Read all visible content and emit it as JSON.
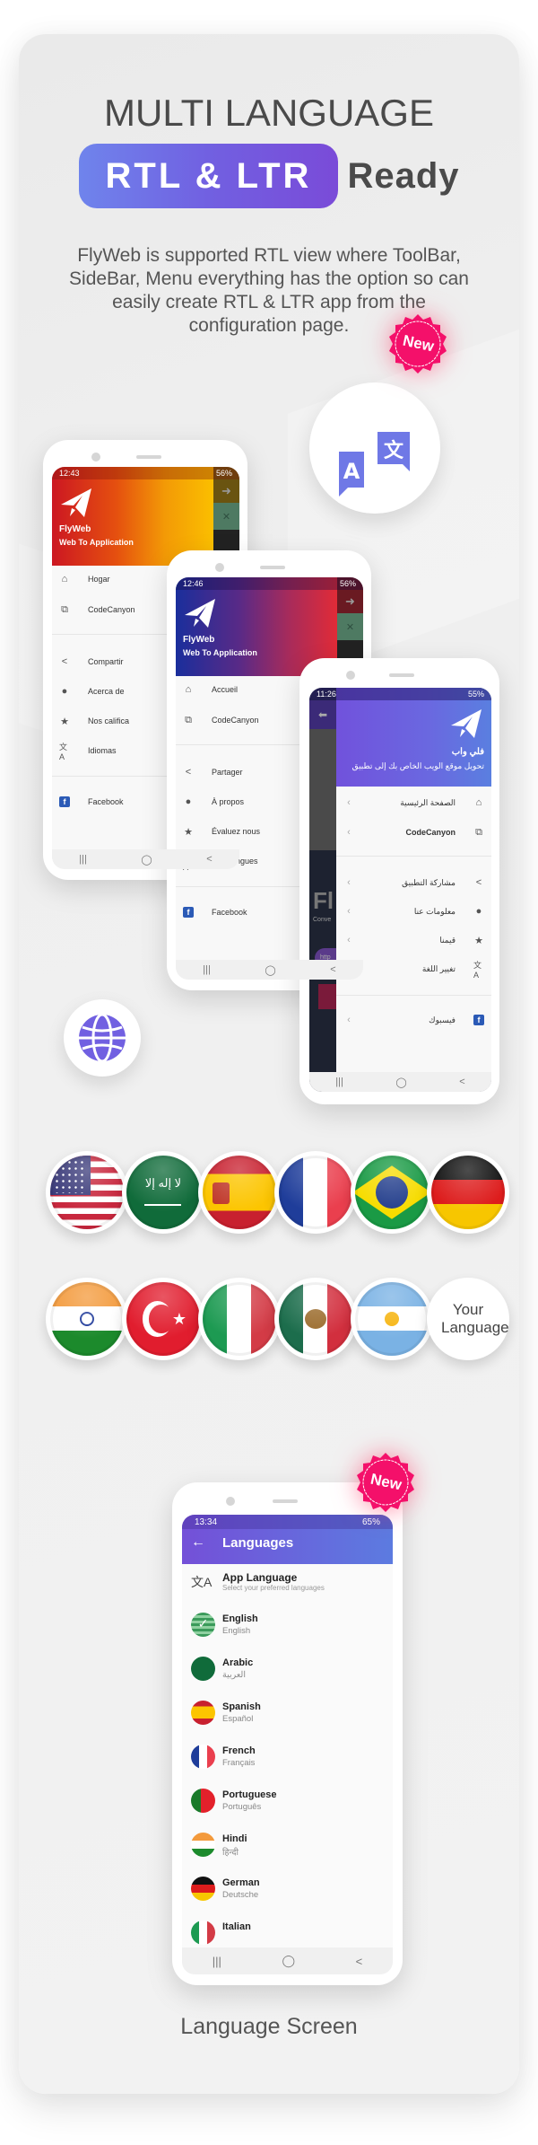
{
  "header": {
    "title": "MULTI LANGUAGE",
    "pill": "RTL & LTR",
    "ready": "Ready",
    "description": "FlyWeb is supported RTL view where ToolBar, SideBar, Menu everything has the option so can easily create RTL & LTR app from the configuration page."
  },
  "badges": {
    "new": "New"
  },
  "icons": {
    "translate": "translate-icon",
    "globe": "globe-icon"
  },
  "colors": {
    "accent": "#7160e1",
    "new_badge": "#ff1a5a",
    "text": "#4a4a4a"
  },
  "phone_spanish": {
    "status_time": "12:43",
    "status_battery": "56%",
    "app_name": "FlyWeb",
    "app_sub": "Web To Application",
    "items": [
      {
        "icon": "home-icon",
        "label": "Hogar"
      },
      {
        "icon": "codecanyon-icon",
        "label": "CodeCanyon"
      },
      {
        "icon": "share-icon",
        "label": "Compartir"
      },
      {
        "icon": "info-icon",
        "label": "Acerca de"
      },
      {
        "icon": "star-icon",
        "label": "Nos califica"
      },
      {
        "icon": "translate-icon",
        "label": "Idiomas"
      },
      {
        "icon": "facebook-icon",
        "label": "Facebook"
      }
    ]
  },
  "phone_french": {
    "status_time": "12:46",
    "status_battery": "56%",
    "app_name": "FlyWeb",
    "app_sub": "Web To Application",
    "items": [
      {
        "icon": "home-icon",
        "label": "Accueil"
      },
      {
        "icon": "codecanyon-icon",
        "label": "CodeCanyon"
      },
      {
        "icon": "share-icon",
        "label": "Partager"
      },
      {
        "icon": "info-icon",
        "label": "À propos"
      },
      {
        "icon": "star-icon",
        "label": "Évaluez nous"
      },
      {
        "icon": "translate-icon",
        "label": "Les Langues"
      },
      {
        "icon": "facebook-icon",
        "label": "Facebook"
      }
    ]
  },
  "phone_arabic": {
    "status_time": "11:26",
    "status_battery": "55%",
    "app_name": "فلي واب",
    "app_sub": "تحويل موقع الويب الخاص بك إلى تطبيق",
    "bg_title": "Fl",
    "bg_sub": "Conve",
    "bg_button": "http",
    "items": [
      {
        "icon": "home-icon",
        "label": "الصفحة الرئيسية"
      },
      {
        "icon": "codecanyon-icon",
        "label": "CodeCanyon"
      },
      {
        "icon": "share-icon",
        "label": "مشاركة التطبيق"
      },
      {
        "icon": "info-icon",
        "label": "معلومات عنا"
      },
      {
        "icon": "star-icon",
        "label": "قيمنا"
      },
      {
        "icon": "translate-icon",
        "label": "تغيير اللغة"
      },
      {
        "icon": "facebook-icon",
        "label": "فيسبوك"
      }
    ]
  },
  "flags_row1": [
    "USA",
    "Saudi Arabia",
    "Spain",
    "France",
    "Brazil",
    "Germany"
  ],
  "flags_row2": [
    "India",
    "Turkey",
    "Italy",
    "Mexico",
    "Argentina"
  ],
  "your_language": "Your Language",
  "language_screen": {
    "status_time": "13:34",
    "status_battery": "65%",
    "title": "Languages",
    "app_language_title": "App Language",
    "app_language_sub": "Select your preferred languages",
    "languages": [
      {
        "name": "English",
        "native": "English",
        "selected": true
      },
      {
        "name": "Arabic",
        "native": "العربية",
        "selected": false
      },
      {
        "name": "Spanish",
        "native": "Español",
        "selected": false
      },
      {
        "name": "French",
        "native": "Français",
        "selected": false
      },
      {
        "name": "Portuguese",
        "native": "Português",
        "selected": false
      },
      {
        "name": "Hindi",
        "native": "हिन्दी",
        "selected": false
      },
      {
        "name": "German",
        "native": "Deutsche",
        "selected": false
      },
      {
        "name": "Italian",
        "native": "",
        "selected": false
      }
    ]
  },
  "caption": "Language Screen"
}
